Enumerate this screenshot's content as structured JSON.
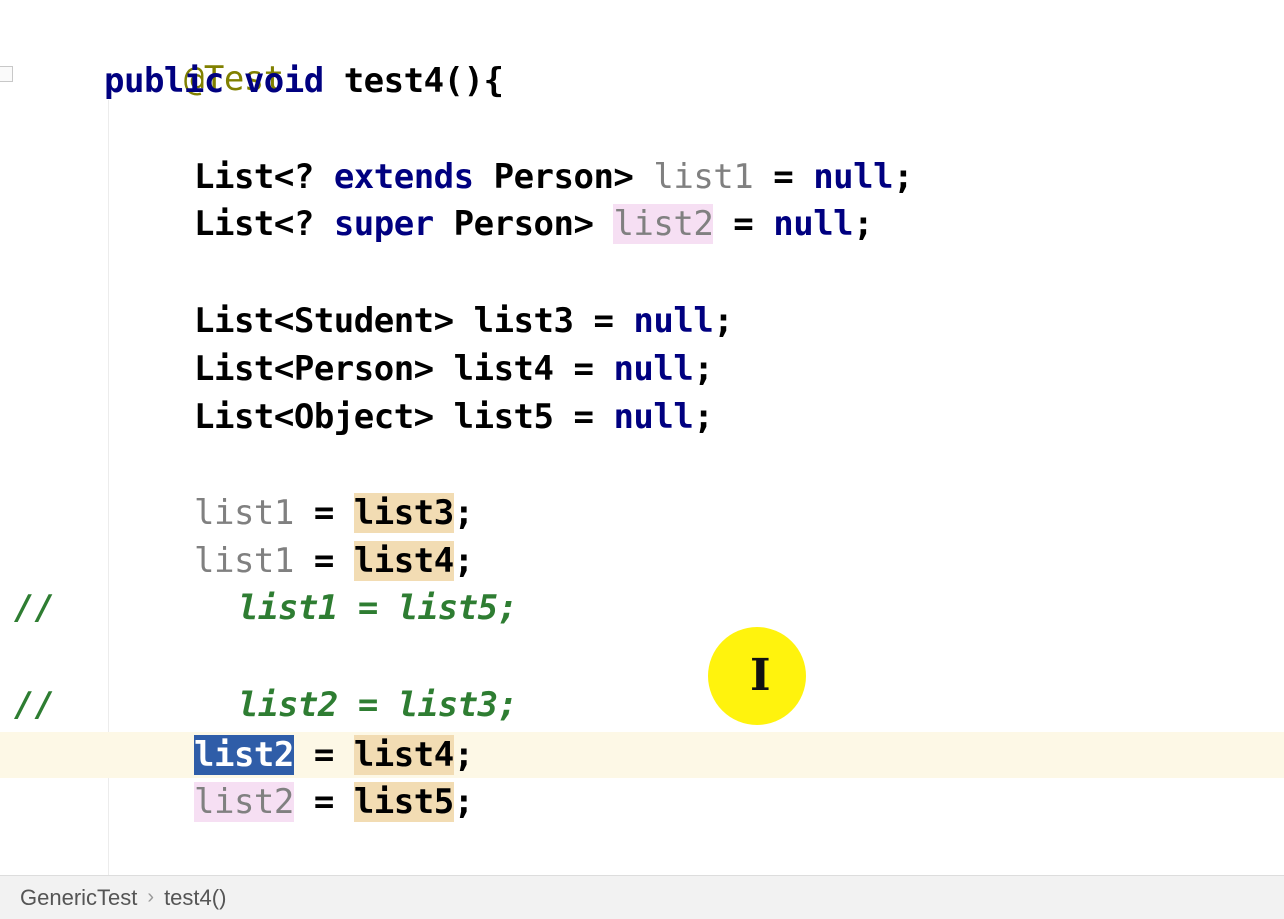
{
  "code": {
    "annotation": "@Test",
    "method_signature": {
      "kw1": "public",
      "kw2": "void",
      "name": "test4(){"
    },
    "line_list1_decl": {
      "a": "List<?",
      "kw": "extends",
      "b": "Person>",
      "var": "list1",
      "eq": "=",
      "null": "null",
      "semi": ";"
    },
    "line_list2_decl": {
      "a": "List<?",
      "kw": "super",
      "b": "Person>",
      "var": "list2",
      "eq": "=",
      "null": "null",
      "semi": ";"
    },
    "line_list3_decl": {
      "type": "List<Student>",
      "var": "list3",
      "eq": "=",
      "null": "null",
      "semi": ";"
    },
    "line_list4_decl": {
      "type": "List<Person>",
      "var": "list4",
      "eq": "=",
      "null": "null",
      "semi": ";"
    },
    "line_list5_decl": {
      "type": "List<Object>",
      "var": "list5",
      "eq": "=",
      "null": "null",
      "semi": ";"
    },
    "assign1": {
      "lhs": "list1",
      "eq": "=",
      "rhs": "list3",
      "semi": ";"
    },
    "assign2": {
      "lhs": "list1",
      "eq": "=",
      "rhs": "list4",
      "semi": ";"
    },
    "comment1": {
      "marker": "//",
      "text": "list1 = list5;"
    },
    "comment2": {
      "marker": "//",
      "text": "list2 = list3;"
    },
    "assign3": {
      "lhs": "list2",
      "eq": "=",
      "rhs": "list4",
      "semi": ";"
    },
    "assign4": {
      "lhs": "list2",
      "eq": "=",
      "rhs": "list5",
      "semi": ";"
    }
  },
  "breadcrumb": {
    "class_name": "GenericTest",
    "separator": "›",
    "method_name": "test4()"
  },
  "colors": {
    "keyword": "#000080",
    "annotation": "#808000",
    "comment": "#2e7d32",
    "selection": "#2f5da8",
    "read_highlight": "#f2dcb3",
    "cursor_ring": "#fff200"
  }
}
